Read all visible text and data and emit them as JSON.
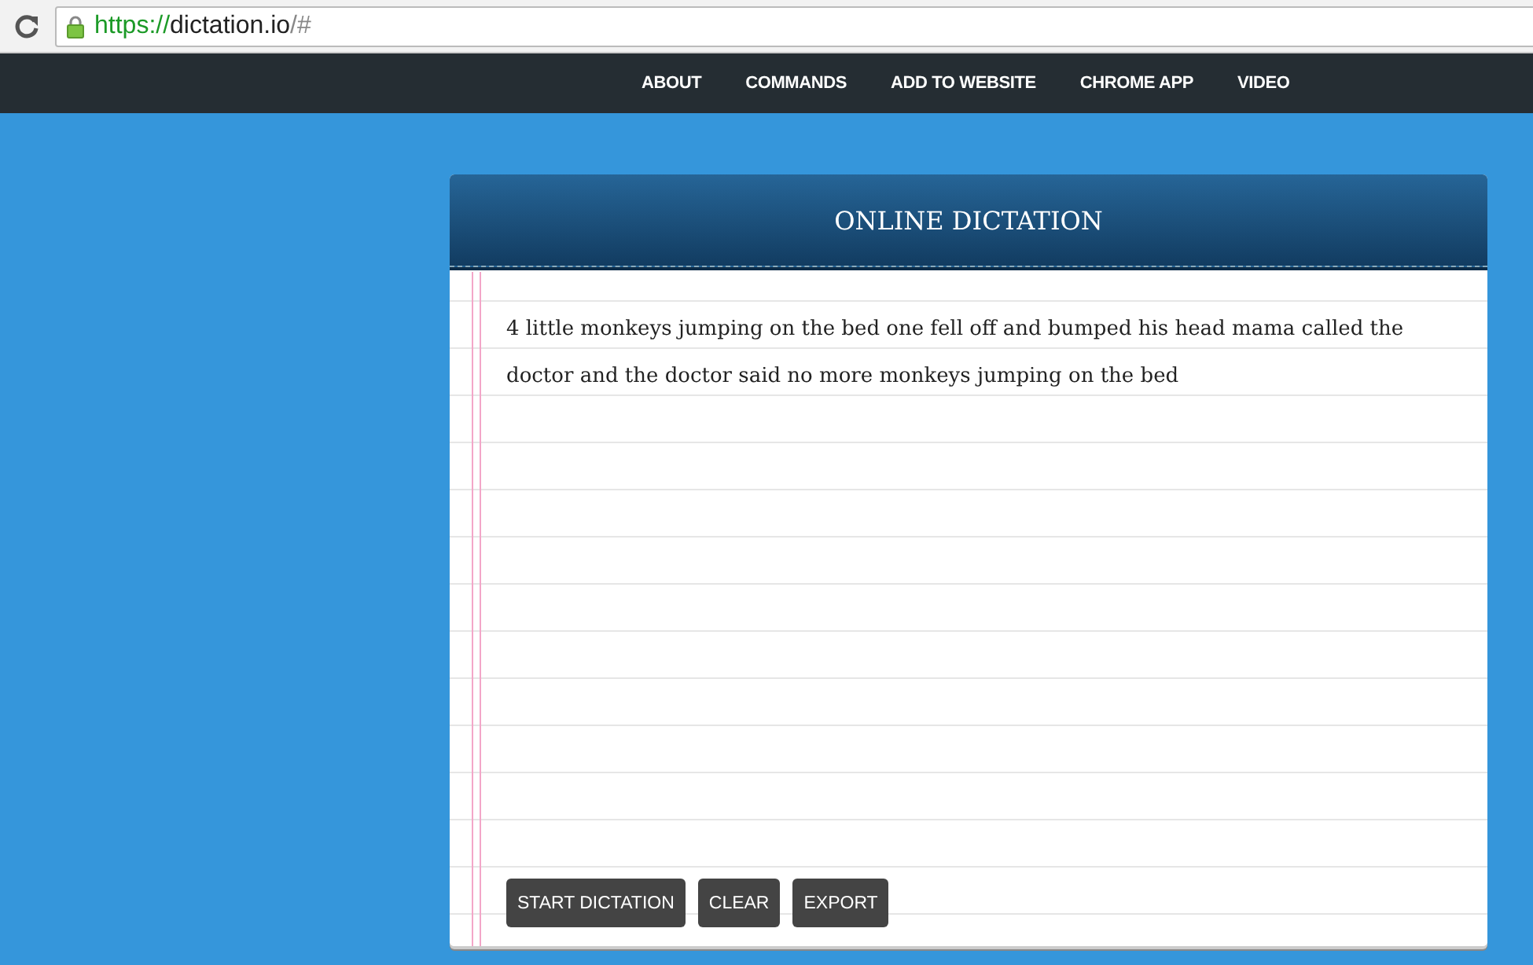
{
  "browser": {
    "url_scheme": "https://",
    "url_host": "dictation.io",
    "url_path": "/#"
  },
  "nav": {
    "items": [
      "ABOUT",
      "COMMANDS",
      "ADD TO WEBSITE",
      "CHROME APP",
      "VIDEO"
    ]
  },
  "card": {
    "title": "ONLINE DICTATION",
    "text": "4 little monkeys jumping on the bed one fell off and bumped his head mama called the doctor and the doctor said no more monkeys jumping on the bed",
    "buttons": [
      "START DICTATION",
      "CLEAR",
      "EXPORT"
    ]
  }
}
